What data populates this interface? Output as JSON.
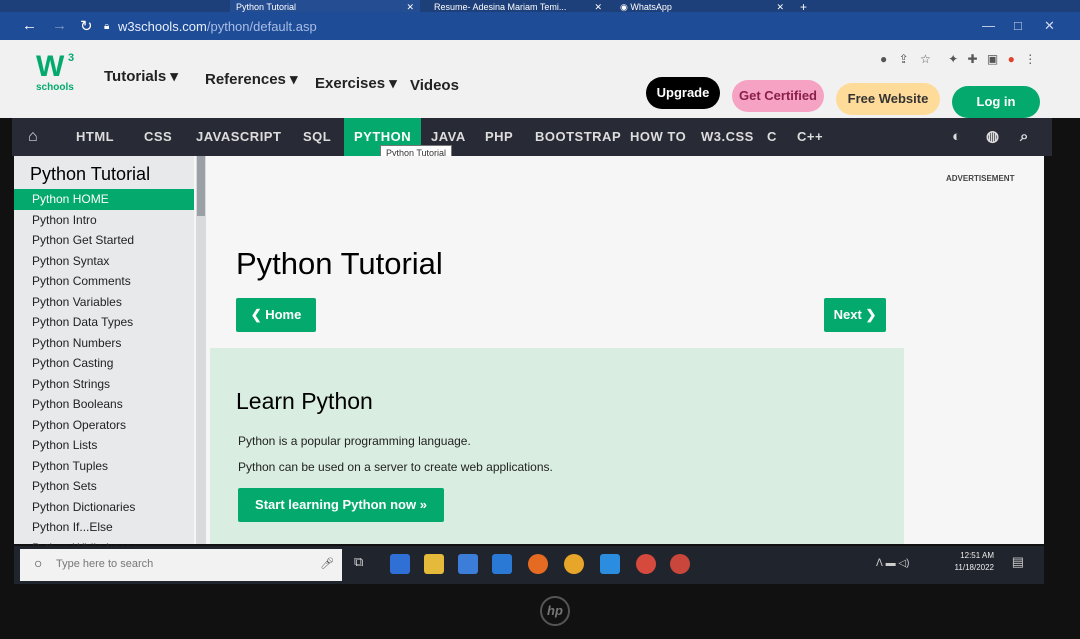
{
  "browser": {
    "tabs": [
      {
        "label": "Python Tutorial",
        "active": true
      },
      {
        "label": "Resume- Adesina Mariam Temi...",
        "active": false
      },
      {
        "label": "WhatsApp",
        "active": false
      }
    ],
    "url_host": "w3schools.com",
    "url_path": "/python/default.asp"
  },
  "header": {
    "logo_top": "W",
    "logo_sup": "3",
    "logo_bottom": "schools",
    "menu": [
      "Tutorials ▾",
      "References ▾",
      "Exercises ▾",
      "Videos"
    ],
    "buttons": {
      "upgrade": "Upgrade",
      "certified": "Get Certified",
      "free_website": "Free Website",
      "login": "Log in"
    }
  },
  "navbar": {
    "items": [
      "HTML",
      "CSS",
      "JAVASCRIPT",
      "SQL",
      "PYTHON",
      "JAVA",
      "PHP",
      "BOOTSTRAP",
      "HOW TO",
      "W3.CSS",
      "C",
      "C++"
    ],
    "active": "PYTHON",
    "tooltip": "Python Tutorial"
  },
  "sidebar": {
    "title": "Python Tutorial",
    "items": [
      "Python HOME",
      "Python Intro",
      "Python Get Started",
      "Python Syntax",
      "Python Comments",
      "Python Variables",
      "Python Data Types",
      "Python Numbers",
      "Python Casting",
      "Python Strings",
      "Python Booleans",
      "Python Operators",
      "Python Lists",
      "Python Tuples",
      "Python Sets",
      "Python Dictionaries",
      "Python If...Else",
      "Python While Loops"
    ],
    "active_index": 0
  },
  "main": {
    "title": "Python Tutorial",
    "home_button": "❮ Home",
    "next_button": "Next ❯",
    "advertisement": "ADVERTISEMENT",
    "learn": {
      "heading": "Learn Python",
      "p1": "Python is a popular programming language.",
      "p2": "Python can be used on a server to create web applications.",
      "cta": "Start learning Python now »"
    }
  },
  "taskbar": {
    "search_placeholder": "Type here to search",
    "time": "12:51 AM",
    "date": "11/18/2022"
  },
  "colors": {
    "brand_green": "#04AA6D",
    "navbar_dark": "#282A35",
    "upgrade_bg": "#000000",
    "certified_bg": "#F6A3C3",
    "free_website_bg": "#FFDB9A",
    "login_bg": "#04AA6D"
  }
}
